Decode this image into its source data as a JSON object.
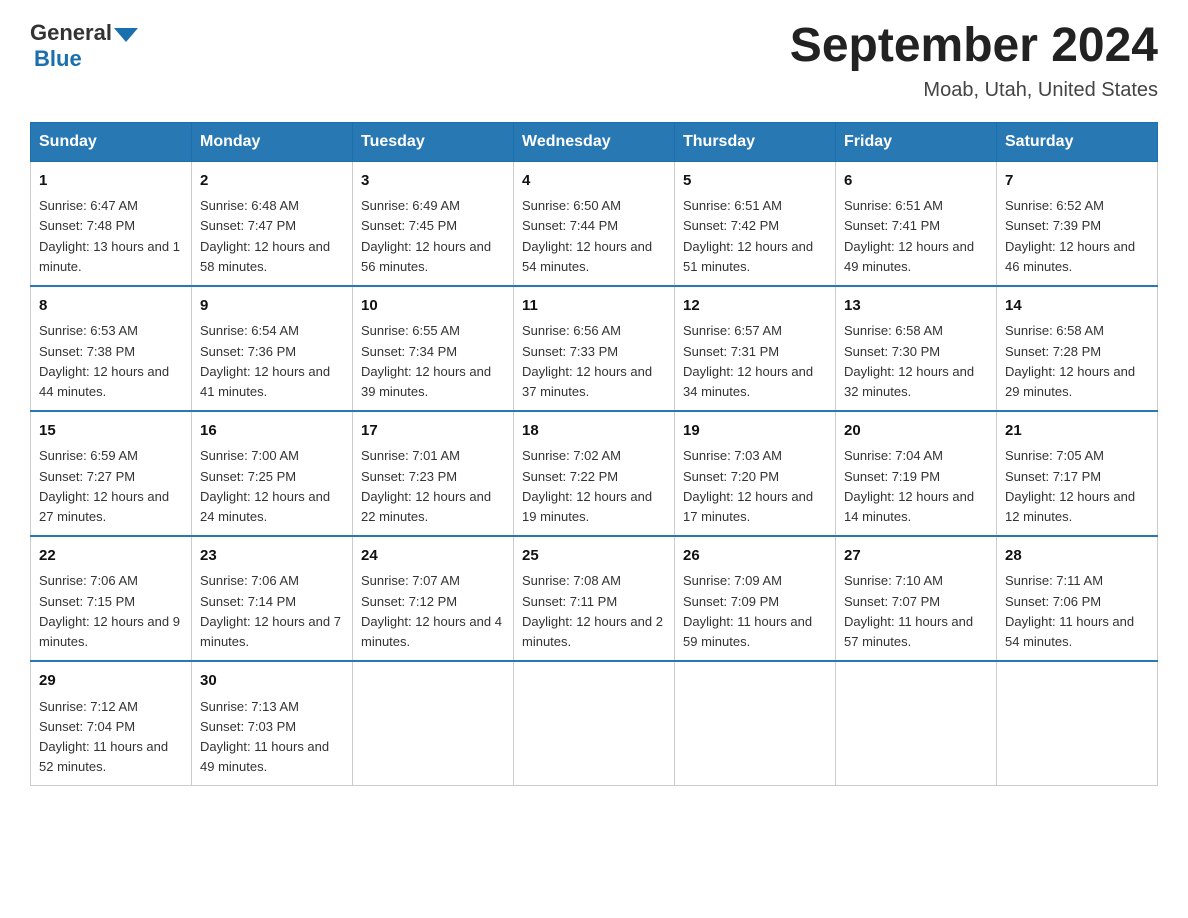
{
  "header": {
    "title": "September 2024",
    "subtitle": "Moab, Utah, United States",
    "logo_general": "General",
    "logo_blue": "Blue"
  },
  "days_of_week": [
    "Sunday",
    "Monday",
    "Tuesday",
    "Wednesday",
    "Thursday",
    "Friday",
    "Saturday"
  ],
  "weeks": [
    [
      {
        "day": "1",
        "sunrise": "Sunrise: 6:47 AM",
        "sunset": "Sunset: 7:48 PM",
        "daylight": "Daylight: 13 hours and 1 minute."
      },
      {
        "day": "2",
        "sunrise": "Sunrise: 6:48 AM",
        "sunset": "Sunset: 7:47 PM",
        "daylight": "Daylight: 12 hours and 58 minutes."
      },
      {
        "day": "3",
        "sunrise": "Sunrise: 6:49 AM",
        "sunset": "Sunset: 7:45 PM",
        "daylight": "Daylight: 12 hours and 56 minutes."
      },
      {
        "day": "4",
        "sunrise": "Sunrise: 6:50 AM",
        "sunset": "Sunset: 7:44 PM",
        "daylight": "Daylight: 12 hours and 54 minutes."
      },
      {
        "day": "5",
        "sunrise": "Sunrise: 6:51 AM",
        "sunset": "Sunset: 7:42 PM",
        "daylight": "Daylight: 12 hours and 51 minutes."
      },
      {
        "day": "6",
        "sunrise": "Sunrise: 6:51 AM",
        "sunset": "Sunset: 7:41 PM",
        "daylight": "Daylight: 12 hours and 49 minutes."
      },
      {
        "day": "7",
        "sunrise": "Sunrise: 6:52 AM",
        "sunset": "Sunset: 7:39 PM",
        "daylight": "Daylight: 12 hours and 46 minutes."
      }
    ],
    [
      {
        "day": "8",
        "sunrise": "Sunrise: 6:53 AM",
        "sunset": "Sunset: 7:38 PM",
        "daylight": "Daylight: 12 hours and 44 minutes."
      },
      {
        "day": "9",
        "sunrise": "Sunrise: 6:54 AM",
        "sunset": "Sunset: 7:36 PM",
        "daylight": "Daylight: 12 hours and 41 minutes."
      },
      {
        "day": "10",
        "sunrise": "Sunrise: 6:55 AM",
        "sunset": "Sunset: 7:34 PM",
        "daylight": "Daylight: 12 hours and 39 minutes."
      },
      {
        "day": "11",
        "sunrise": "Sunrise: 6:56 AM",
        "sunset": "Sunset: 7:33 PM",
        "daylight": "Daylight: 12 hours and 37 minutes."
      },
      {
        "day": "12",
        "sunrise": "Sunrise: 6:57 AM",
        "sunset": "Sunset: 7:31 PM",
        "daylight": "Daylight: 12 hours and 34 minutes."
      },
      {
        "day": "13",
        "sunrise": "Sunrise: 6:58 AM",
        "sunset": "Sunset: 7:30 PM",
        "daylight": "Daylight: 12 hours and 32 minutes."
      },
      {
        "day": "14",
        "sunrise": "Sunrise: 6:58 AM",
        "sunset": "Sunset: 7:28 PM",
        "daylight": "Daylight: 12 hours and 29 minutes."
      }
    ],
    [
      {
        "day": "15",
        "sunrise": "Sunrise: 6:59 AM",
        "sunset": "Sunset: 7:27 PM",
        "daylight": "Daylight: 12 hours and 27 minutes."
      },
      {
        "day": "16",
        "sunrise": "Sunrise: 7:00 AM",
        "sunset": "Sunset: 7:25 PM",
        "daylight": "Daylight: 12 hours and 24 minutes."
      },
      {
        "day": "17",
        "sunrise": "Sunrise: 7:01 AM",
        "sunset": "Sunset: 7:23 PM",
        "daylight": "Daylight: 12 hours and 22 minutes."
      },
      {
        "day": "18",
        "sunrise": "Sunrise: 7:02 AM",
        "sunset": "Sunset: 7:22 PM",
        "daylight": "Daylight: 12 hours and 19 minutes."
      },
      {
        "day": "19",
        "sunrise": "Sunrise: 7:03 AM",
        "sunset": "Sunset: 7:20 PM",
        "daylight": "Daylight: 12 hours and 17 minutes."
      },
      {
        "day": "20",
        "sunrise": "Sunrise: 7:04 AM",
        "sunset": "Sunset: 7:19 PM",
        "daylight": "Daylight: 12 hours and 14 minutes."
      },
      {
        "day": "21",
        "sunrise": "Sunrise: 7:05 AM",
        "sunset": "Sunset: 7:17 PM",
        "daylight": "Daylight: 12 hours and 12 minutes."
      }
    ],
    [
      {
        "day": "22",
        "sunrise": "Sunrise: 7:06 AM",
        "sunset": "Sunset: 7:15 PM",
        "daylight": "Daylight: 12 hours and 9 minutes."
      },
      {
        "day": "23",
        "sunrise": "Sunrise: 7:06 AM",
        "sunset": "Sunset: 7:14 PM",
        "daylight": "Daylight: 12 hours and 7 minutes."
      },
      {
        "day": "24",
        "sunrise": "Sunrise: 7:07 AM",
        "sunset": "Sunset: 7:12 PM",
        "daylight": "Daylight: 12 hours and 4 minutes."
      },
      {
        "day": "25",
        "sunrise": "Sunrise: 7:08 AM",
        "sunset": "Sunset: 7:11 PM",
        "daylight": "Daylight: 12 hours and 2 minutes."
      },
      {
        "day": "26",
        "sunrise": "Sunrise: 7:09 AM",
        "sunset": "Sunset: 7:09 PM",
        "daylight": "Daylight: 11 hours and 59 minutes."
      },
      {
        "day": "27",
        "sunrise": "Sunrise: 7:10 AM",
        "sunset": "Sunset: 7:07 PM",
        "daylight": "Daylight: 11 hours and 57 minutes."
      },
      {
        "day": "28",
        "sunrise": "Sunrise: 7:11 AM",
        "sunset": "Sunset: 7:06 PM",
        "daylight": "Daylight: 11 hours and 54 minutes."
      }
    ],
    [
      {
        "day": "29",
        "sunrise": "Sunrise: 7:12 AM",
        "sunset": "Sunset: 7:04 PM",
        "daylight": "Daylight: 11 hours and 52 minutes."
      },
      {
        "day": "30",
        "sunrise": "Sunrise: 7:13 AM",
        "sunset": "Sunset: 7:03 PM",
        "daylight": "Daylight: 11 hours and 49 minutes."
      },
      null,
      null,
      null,
      null,
      null
    ]
  ]
}
